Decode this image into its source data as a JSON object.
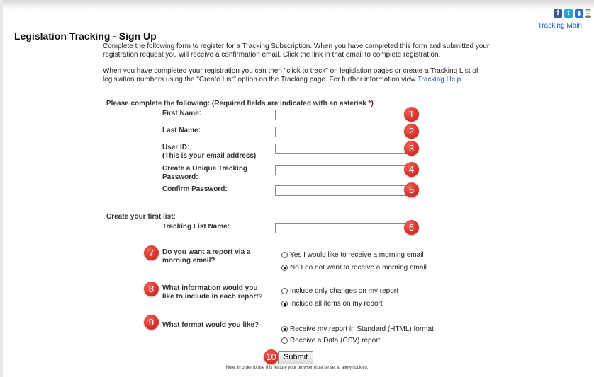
{
  "header": {
    "social_icons": [
      "facebook-icon",
      "twitter-icon",
      "download-icon",
      "print-icon"
    ],
    "tracking_main_link": "Tracking Main"
  },
  "page": {
    "title": "Legislation Tracking - Sign Up",
    "intro_1": "Complete the following form to register for a Tracking Subscription. When you have completed this form and submitted your registration request you will receive a confirmation email. Click the link in that email to complete registration.",
    "intro_2": "When you have completed your registration you can then \"click to track\" on legislation pages or create a Tracking List of legislation numbers using the \"Create List\" option on the Tracking page. For further information view",
    "help_link": "Tracking Help",
    "help_suffix": "."
  },
  "form": {
    "required_note_prefix": "Please complete the following: (Required fields are indicated with an asterisk",
    "required_asterisk": "*",
    "required_note_suffix": ")",
    "first_name_label": "First Name:",
    "last_name_label": "Last Name:",
    "user_id_label": "User ID:",
    "user_id_hint": "(This is your email address)",
    "password_label": "Create a Unique Tracking Password:",
    "confirm_label": "Confirm Password:",
    "first_name": "",
    "last_name": "",
    "user_id": "",
    "password": "",
    "confirm_password": "",
    "list_heading": "Create your first list:",
    "list_name_label": "Tracking List Name:",
    "list_name": "",
    "q_email": "Do you want a report via a morning email?",
    "email_yes": "Yes I would like to receive a morning email",
    "email_no": "No I do not want to receive a morning email",
    "email_selected": "no",
    "q_content": "What information would you like to include in each report?",
    "content_changes": "Include only changes on my report",
    "content_all": "Include all items on my report",
    "content_selected": "all",
    "q_format": "What format would you like?",
    "format_html": "Receive my report in Standard (HTML) format",
    "format_csv": "Receive a Data (CSV) report",
    "format_selected": "html",
    "submit_label": "Submit",
    "cookie_note": "Note: In order to use this feature your browser must be set to allow cookies."
  },
  "badges": [
    "1",
    "2",
    "3",
    "4",
    "5",
    "6",
    "7",
    "8",
    "9",
    "10"
  ],
  "colors": {
    "badge": "#d8322a",
    "link": "#2a5db0",
    "required": "#d81c1c"
  }
}
